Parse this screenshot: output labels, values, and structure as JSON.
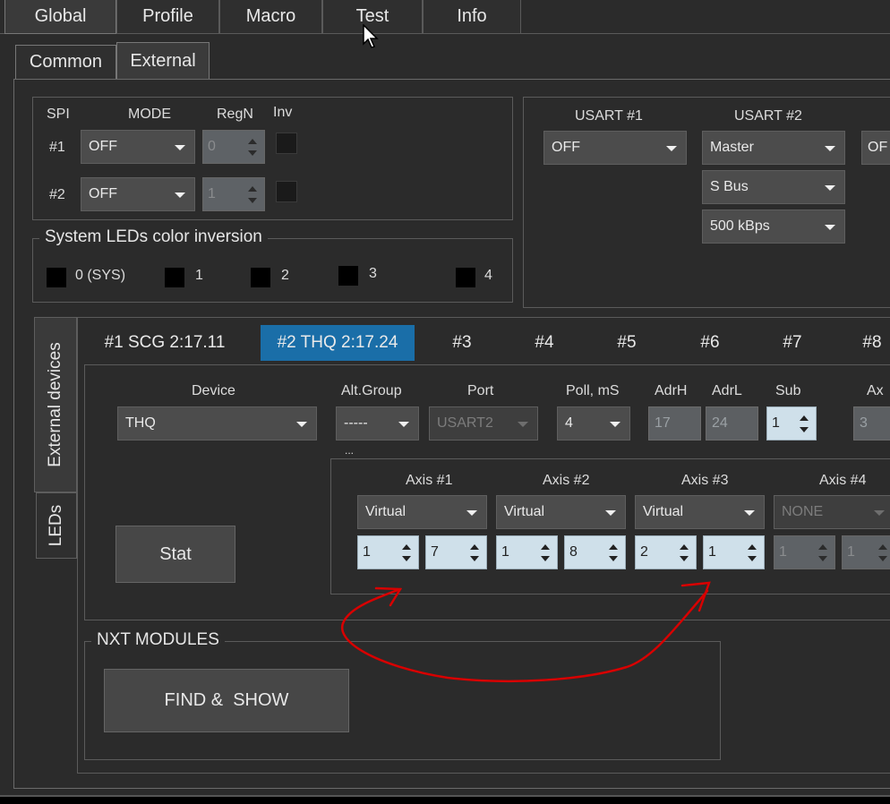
{
  "top_tabs": [
    "Global",
    "Profile",
    "Macro",
    "Test",
    "Info"
  ],
  "sub_tabs": [
    "Common",
    "External"
  ],
  "spi": {
    "headers": {
      "spi": "SPI",
      "mode": "MODE",
      "regn": "RegN",
      "inv": "Inv"
    },
    "rows": [
      {
        "label": "#1",
        "mode": "OFF",
        "regn": "0"
      },
      {
        "label": "#2",
        "mode": "OFF",
        "regn": "1"
      }
    ]
  },
  "system_leds": {
    "title": "System LEDs color inversion",
    "items": [
      "0 (SYS)",
      "1",
      "2",
      "3",
      "4"
    ]
  },
  "usart": {
    "header1": "USART #1",
    "header2": "USART #2",
    "usart1_mode": "OFF",
    "usart2_mode": "Master",
    "usart2_protocol": "S Bus",
    "usart2_speed": "500 kBps",
    "usart3_mode_partial": "OF"
  },
  "side_tabs": [
    "External devices",
    "LEDs"
  ],
  "device_tabs": [
    "#1 SCG 2:17.11",
    "#2 THQ 2:17.24",
    "#3",
    "#4",
    "#5",
    "#6",
    "#7",
    "#8"
  ],
  "device": {
    "headers": {
      "device": "Device",
      "alt_group": "Alt.Group",
      "port": "Port",
      "poll": "Poll, mS",
      "adrh": "AdrH",
      "adrl": "AdrL",
      "sub": "Sub",
      "ax": "Ax"
    },
    "device_value": "THQ",
    "alt_group_value": "-----",
    "alt_group_extra": "...",
    "port_value": "USART2",
    "poll_value": "4",
    "adrh_value": "17",
    "adrl_value": "24",
    "sub_value": "1",
    "ax_value": "3",
    "stat_label": "Stat"
  },
  "axes": [
    {
      "label": "Axis #1",
      "mode": "Virtual",
      "a": "1",
      "b": "7"
    },
    {
      "label": "Axis #2",
      "mode": "Virtual",
      "a": "1",
      "b": "8"
    },
    {
      "label": "Axis #3",
      "mode": "Virtual",
      "a": "2",
      "b": "1"
    },
    {
      "label": "Axis #4",
      "mode": "NONE",
      "a": "1",
      "b": "1"
    }
  ],
  "nxt": {
    "title": "NXT MODULES",
    "button": "FIND &  SHOW"
  },
  "colors": {
    "background": "#2b2b2b",
    "accent_tab": "#1a6ea8",
    "spin_bg": "#cfe0ea",
    "annotation": "#d80000"
  },
  "icons": [
    "mouse-cursor-icon",
    "dropdown-arrow-icon",
    "spin-arrows-icon"
  ]
}
